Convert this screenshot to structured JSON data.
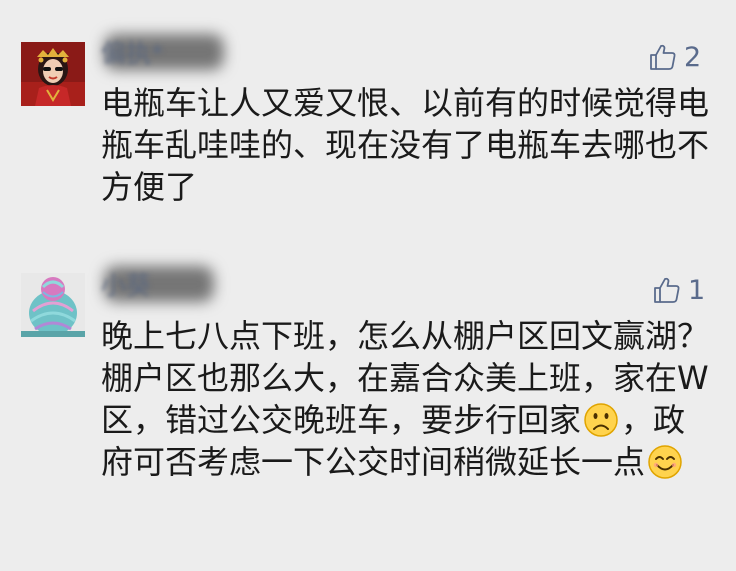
{
  "comments": [
    {
      "nickname": "偏执*",
      "likes": "2",
      "avatar_icon": "bride-avatar-icon",
      "text": "电瓶车让人又爱又恨、以前有的时候觉得电瓶车乱哇哇的、现在没有了电瓶车去哪也不方便了"
    },
    {
      "nickname": "小葵",
      "likes": "1",
      "avatar_icon": "colorful-bun-hair-avatar-icon",
      "text_part1": "晚上七八点下班，怎么从棚户区回文赢湖？棚户区也那么大，在嘉合众美上",
      "text_part2": "班，家在W区，错过公交晚班车，要步行回家",
      "emoji1": "sad-face-emoji",
      "text_part3": "，政府可否考虑一下公交时间稍微延长一点",
      "emoji2": "smile-face-emoji"
    }
  ],
  "colors": {
    "background": "#ededed",
    "nickname": "#5e6a80",
    "like": "#5a6b8c",
    "text": "#1a1a1a"
  }
}
